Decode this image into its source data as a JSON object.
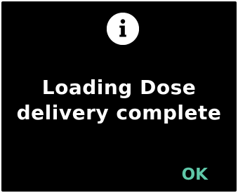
{
  "icon": "info-icon",
  "message": {
    "line1": "Loading Dose",
    "line2": "delivery complete"
  },
  "actions": {
    "ok_label": "OK"
  },
  "colors": {
    "background": "#000000",
    "text": "#ffffff",
    "accent": "#5fc7a8"
  }
}
